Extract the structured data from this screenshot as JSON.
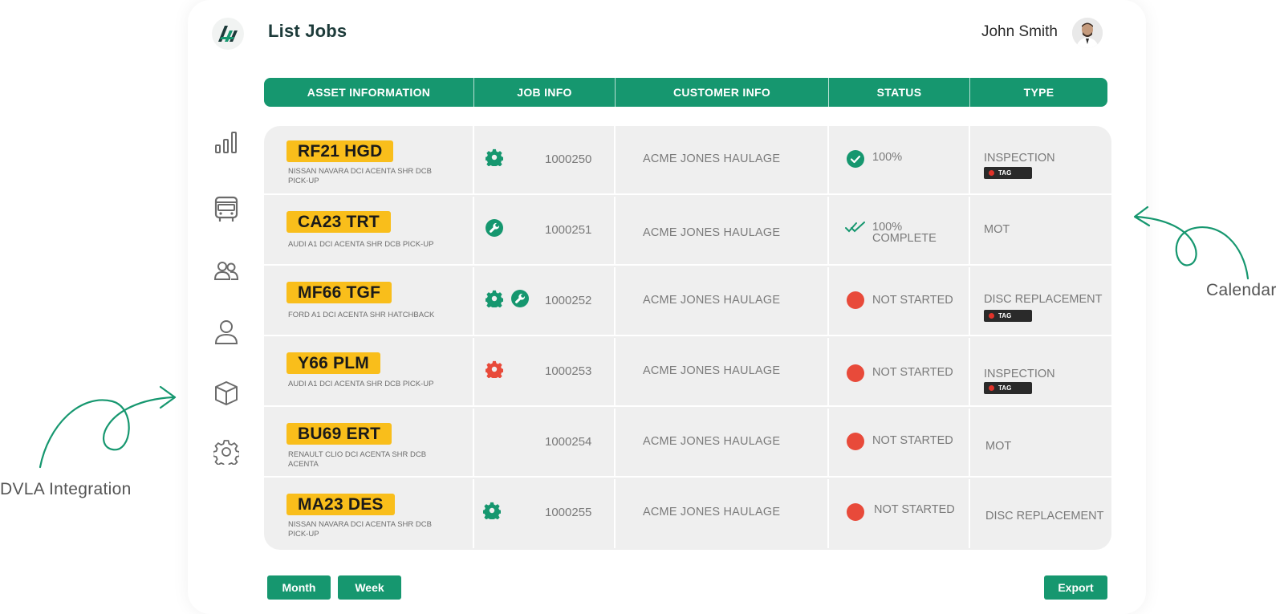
{
  "header": {
    "title": "List Jobs",
    "user_name": "John Smith"
  },
  "sidebar": {
    "items": [
      {
        "icon": "bar-chart-icon"
      },
      {
        "icon": "bus-icon"
      },
      {
        "icon": "users-icon"
      },
      {
        "icon": "user-icon"
      },
      {
        "icon": "box-icon"
      },
      {
        "icon": "gear-icon"
      }
    ]
  },
  "table": {
    "columns": [
      "ASSET INFORMATION",
      "JOB INFO",
      "CUSTOMER INFO",
      "STATUS",
      "TYPE"
    ],
    "rows": [
      {
        "plate": "RF21 HGD",
        "desc": "NISSAN NAVARA DCI ACENTA SHR DCB PICK-UP",
        "job_icons": [
          "gear"
        ],
        "job_no": "1000250",
        "customer": "ACME JONES HAULAGE",
        "status": "100%",
        "status_icon": "check-circle",
        "type": "INSPECTION",
        "tag": "TAG"
      },
      {
        "plate": "CA23 TRT",
        "desc": "AUDI A1 DCI ACENTA SHR DCB PICK-UP",
        "job_icons": [
          "wrench"
        ],
        "job_no": "1000251",
        "customer": "ACME JONES HAULAGE",
        "status": "100% COMPLETE",
        "status_icon": "double-check",
        "type": "MOT",
        "tag": ""
      },
      {
        "plate": "MF66 TGF",
        "desc": "FORD A1 DCI ACENTA SHR HATCHBACK",
        "job_icons": [
          "gear",
          "wrench"
        ],
        "job_no": "1000252",
        "customer": "ACME JONES HAULAGE",
        "status": "NOT STARTED",
        "status_icon": "red-dot",
        "type": "DISC REPLACEMENT",
        "tag": "TAG"
      },
      {
        "plate": "Y66 PLM",
        "desc": "AUDI A1 DCI ACENTA SHR DCB PICK-UP",
        "job_icons": [
          "gear-red"
        ],
        "job_no": "1000253",
        "customer": "ACME JONES HAULAGE",
        "status": "NOT STARTED",
        "status_icon": "red-dot",
        "type": "INSPECTION",
        "tag": "TAG"
      },
      {
        "plate": "BU69 ERT",
        "desc": "RENAULT CLIO DCI ACENTA SHR DCB ACENTA",
        "job_icons": [],
        "job_no": "1000254",
        "customer": "ACME JONES HAULAGE",
        "status": "NOT STARTED",
        "status_icon": "red-dot",
        "type": "MOT",
        "tag": ""
      },
      {
        "plate": "MA23 DES",
        "desc": "NISSAN NAVARA DCI ACENTA SHR DCB PICK-UP",
        "job_icons": [
          "gear"
        ],
        "job_no": "1000255",
        "customer": "ACME JONES HAULAGE",
        "status": "NOT STARTED",
        "status_icon": "red-dot",
        "type": "DISC REPLACEMENT",
        "tag": ""
      }
    ]
  },
  "footer": {
    "month_label": "Month",
    "week_label": "Week",
    "export_label": "Export"
  },
  "annotations": {
    "left": "DVLA Integration",
    "right": "Calendar"
  },
  "colors": {
    "accent": "#16976f",
    "plate": "#f9be1b",
    "danger": "#e84a3a",
    "tag": "#2a2a2a"
  }
}
